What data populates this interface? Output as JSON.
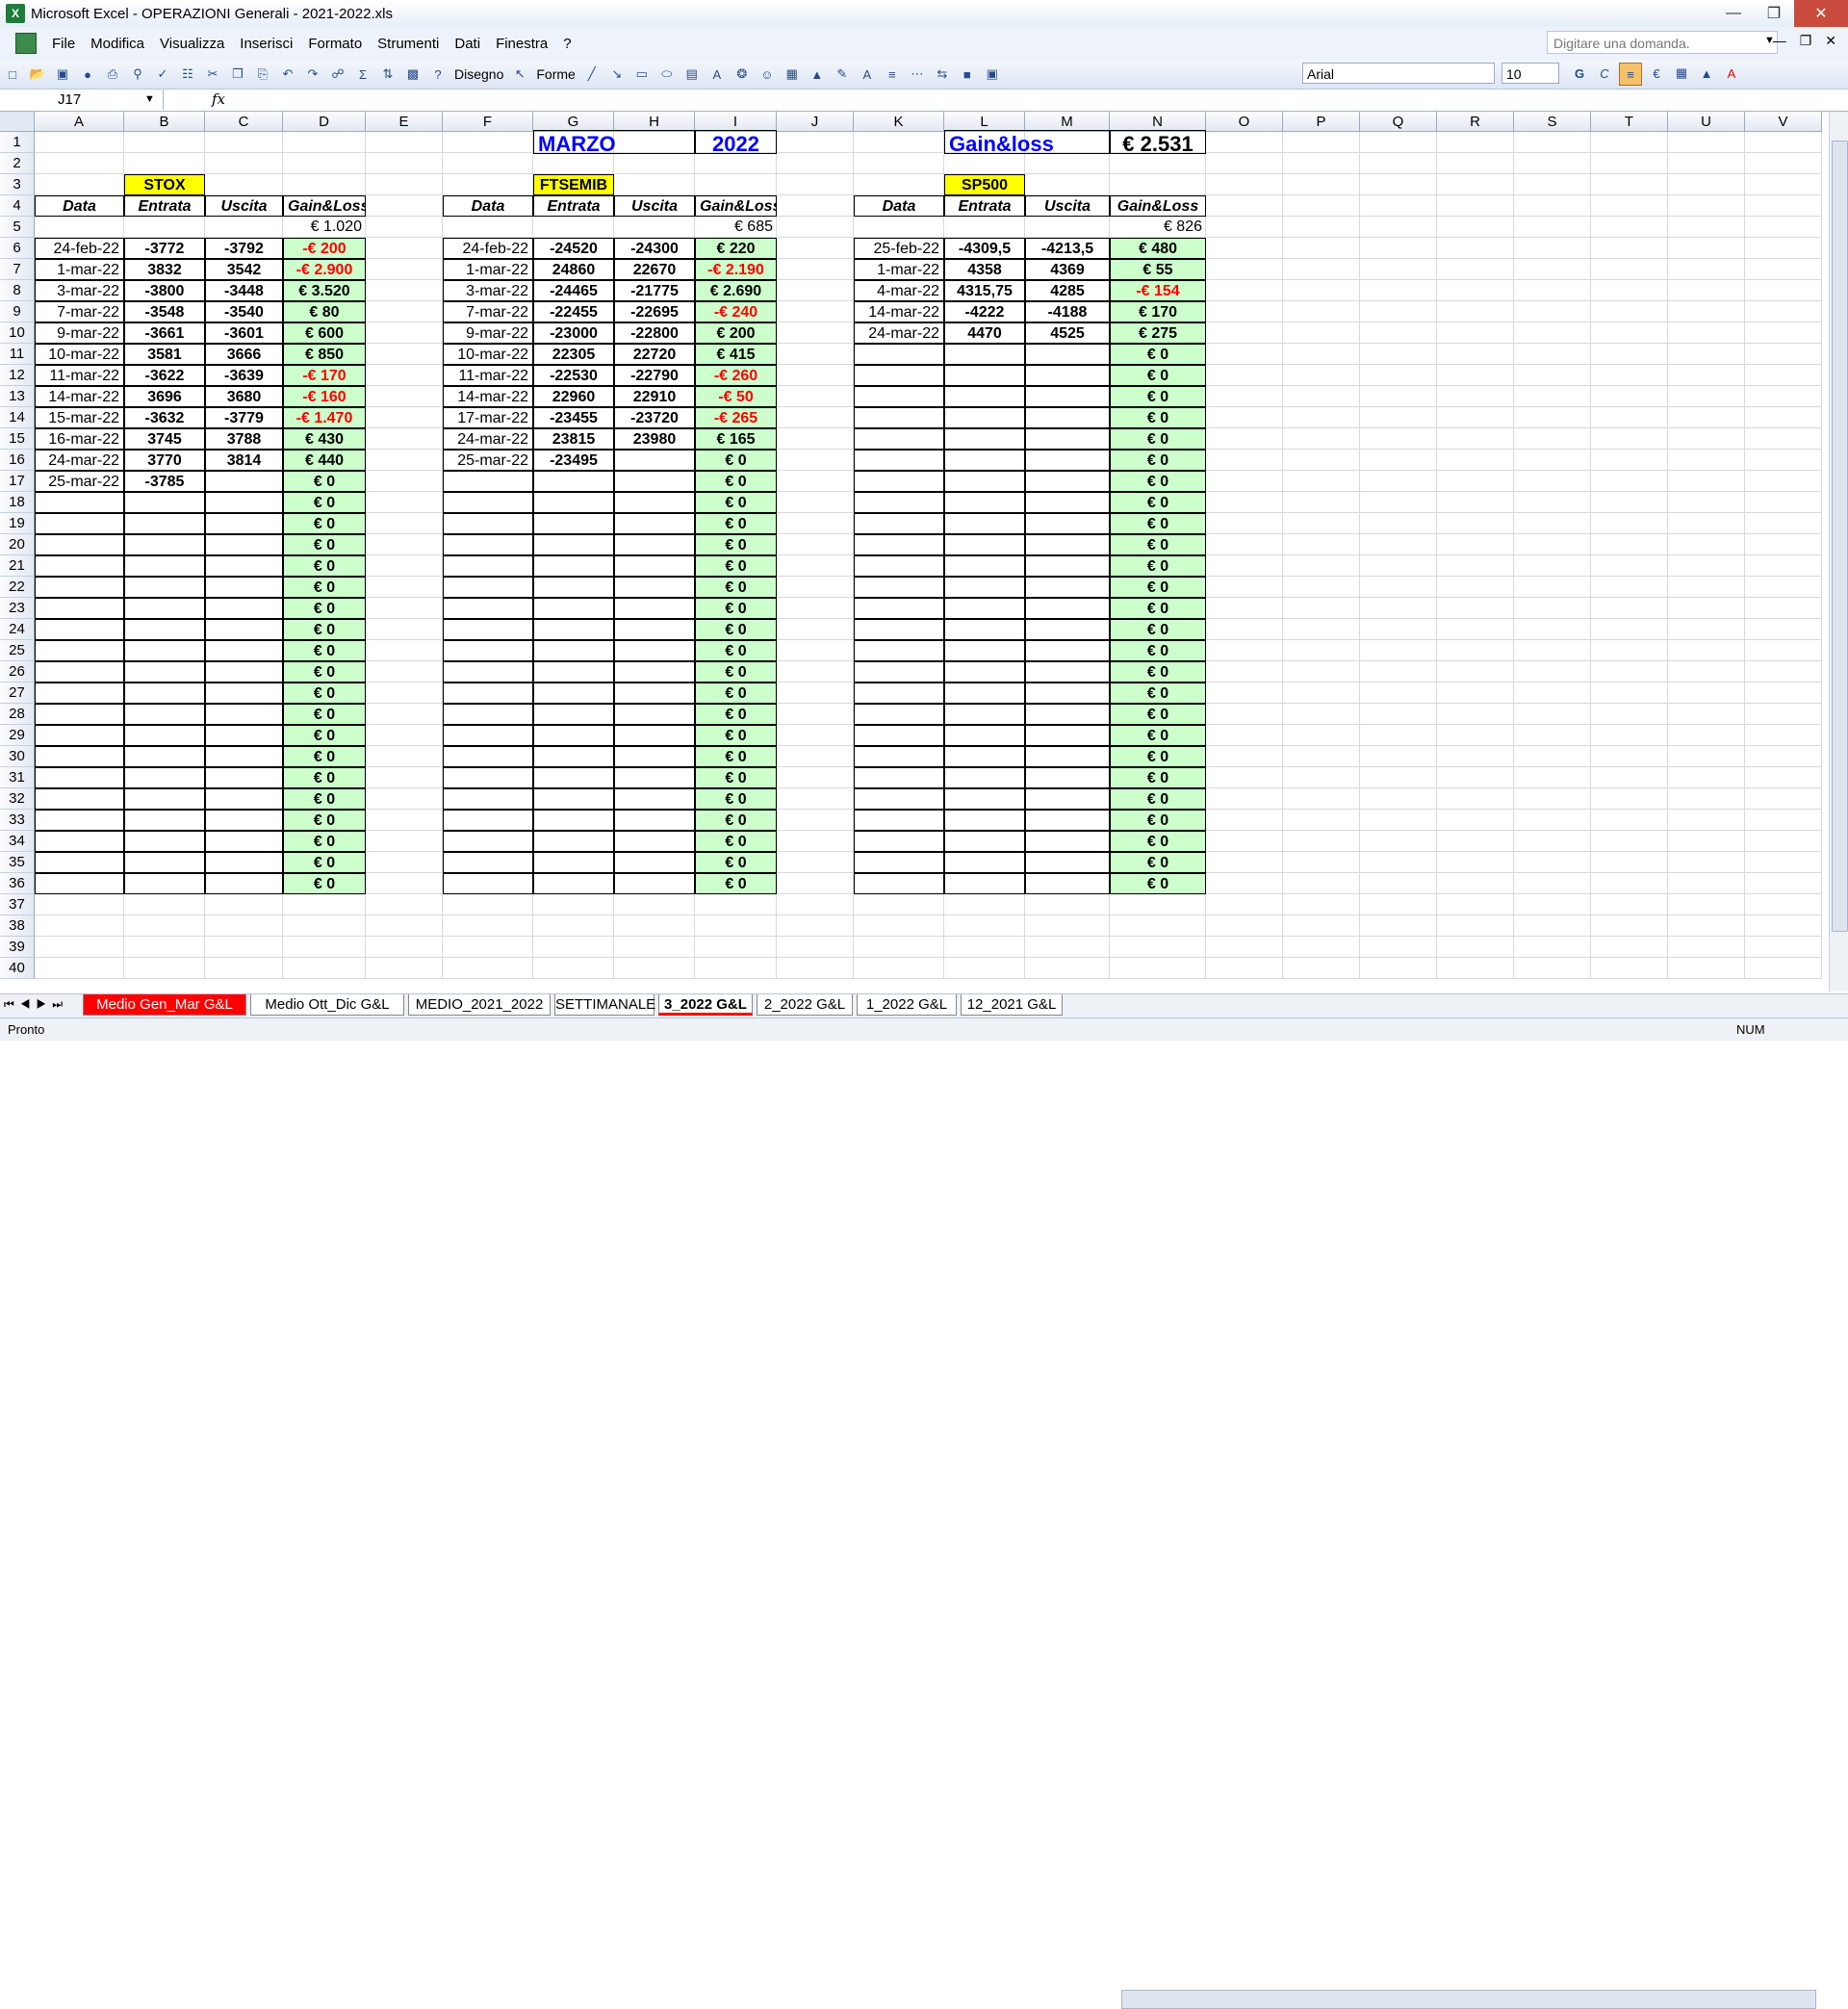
{
  "window": {
    "title": "Microsoft Excel - OPERAZIONI Generali - 2021-2022.xls",
    "app_icon": "excel-icon"
  },
  "menu": {
    "items": [
      "File",
      "Modifica",
      "Visualizza",
      "Inserisci",
      "Formato",
      "Strumenti",
      "Dati",
      "Finestra",
      "?"
    ],
    "ask_placeholder": "Digitare una domanda."
  },
  "toolbar": {
    "disegno": "Disegno",
    "forme": "Forme",
    "font": "Arial",
    "size": "10",
    "bold": "G",
    "italic": "C"
  },
  "formula_bar": {
    "name_box": "J17",
    "fx": "fx"
  },
  "colors": {
    "green": "#ccffcc",
    "yellow": "#ffff00",
    "negative": "#ff0000",
    "blue_text": "#0000ff"
  },
  "columns": [
    "A",
    "B",
    "C",
    "D",
    "E",
    "F",
    "G",
    "H",
    "I",
    "J",
    "K",
    "L",
    "M",
    "N",
    "O",
    "P",
    "Q",
    "R",
    "S",
    "T",
    "U",
    "V"
  ],
  "rows": 40,
  "header": {
    "month": "MARZO",
    "year": "2022",
    "gain_label": "Gain&loss",
    "gain_value": "€ 2.531"
  },
  "section_labels": {
    "stox": "STOX",
    "ftsemib": "FTSEMIB",
    "sp500": "SP500"
  },
  "col_headers": [
    "Data",
    "Entrata",
    "Uscita",
    "Gain&Loss"
  ],
  "stox": {
    "total": "€ 1.020",
    "rows": [
      [
        "24-feb-22",
        "-3772",
        "-3792",
        "-€ 200"
      ],
      [
        "1-mar-22",
        "3832",
        "3542",
        "-€ 2.900"
      ],
      [
        "3-mar-22",
        "-3800",
        "-3448",
        "€ 3.520"
      ],
      [
        "7-mar-22",
        "-3548",
        "-3540",
        "€ 80"
      ],
      [
        "9-mar-22",
        "-3661",
        "-3601",
        "€ 600"
      ],
      [
        "10-mar-22",
        "3581",
        "3666",
        "€ 850"
      ],
      [
        "11-mar-22",
        "-3622",
        "-3639",
        "-€ 170"
      ],
      [
        "14-mar-22",
        "3696",
        "3680",
        "-€ 160"
      ],
      [
        "15-mar-22",
        "-3632",
        "-3779",
        "-€ 1.470"
      ],
      [
        "16-mar-22",
        "3745",
        "3788",
        "€ 430"
      ],
      [
        "24-mar-22",
        "3770",
        "3814",
        "€ 440"
      ],
      [
        "25-mar-22",
        "-3785",
        "",
        "€ 0"
      ]
    ]
  },
  "ftsemib": {
    "total": "€ 685",
    "rows": [
      [
        "24-feb-22",
        "-24520",
        "-24300",
        "€ 220"
      ],
      [
        "1-mar-22",
        "24860",
        "22670",
        "-€ 2.190"
      ],
      [
        "3-mar-22",
        "-24465",
        "-21775",
        "€ 2.690"
      ],
      [
        "7-mar-22",
        "-22455",
        "-22695",
        "-€ 240"
      ],
      [
        "9-mar-22",
        "-23000",
        "-22800",
        "€ 200"
      ],
      [
        "10-mar-22",
        "22305",
        "22720",
        "€ 415"
      ],
      [
        "11-mar-22",
        "-22530",
        "-22790",
        "-€ 260"
      ],
      [
        "14-mar-22",
        "22960",
        "22910",
        "-€ 50"
      ],
      [
        "17-mar-22",
        "-23455",
        "-23720",
        "-€ 265"
      ],
      [
        "24-mar-22",
        "23815",
        "23980",
        "€ 165"
      ],
      [
        "25-mar-22",
        "-23495",
        "",
        "€ 0"
      ]
    ]
  },
  "sp500": {
    "total": "€ 826",
    "rows": [
      [
        "25-feb-22",
        "-4309,5",
        "-4213,5",
        "€ 480"
      ],
      [
        "1-mar-22",
        "4358",
        "4369",
        "€ 55"
      ],
      [
        "4-mar-22",
        "4315,75",
        "4285",
        "-€ 154"
      ],
      [
        "14-mar-22",
        "-4222",
        "-4188",
        "€ 170"
      ],
      [
        "24-mar-22",
        "4470",
        "4525",
        "€ 275"
      ]
    ]
  },
  "zero_value": "€ 0",
  "sheet_tabs": [
    "Medio Gen_Mar G&L",
    "Medio Ott_Dic G&L",
    "MEDIO_2021_2022",
    "SETTIMANALE",
    "3_2022 G&L",
    "2_2022 G&L",
    "1_2022 G&L",
    "12_2021 G&L"
  ],
  "active_tab": "3_2022 G&L",
  "status": {
    "left": "Pronto",
    "right": "NUM"
  }
}
